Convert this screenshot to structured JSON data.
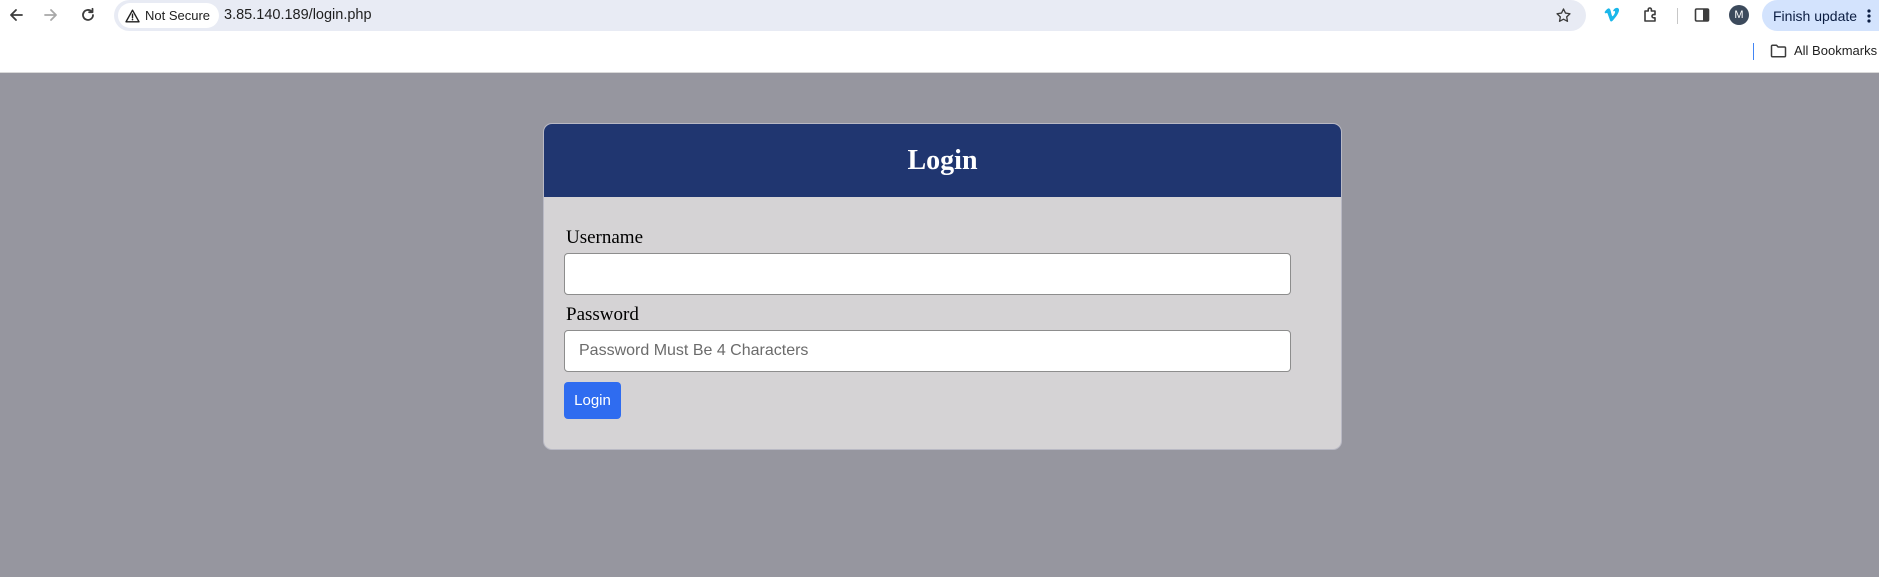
{
  "browser": {
    "security_label": "Not Secure",
    "url": "3.85.140.189/login.php",
    "profile_initial": "M",
    "update_label": "Finish update",
    "bookmarks_label": "All Bookmarks",
    "icons": [
      "back-icon",
      "forward-icon",
      "reload-icon",
      "warning-icon",
      "star-icon",
      "vimeo-icon",
      "extensions-icon",
      "side-panel-icon",
      "kebab-menu-icon",
      "folder-icon"
    ]
  },
  "login": {
    "title": "Login",
    "username_label": "Username",
    "username_value": "",
    "password_label": "Password",
    "password_placeholder": "Password Must Be 4 Characters",
    "submit_label": "Login"
  },
  "colors": {
    "page_background": "#96969f",
    "header": "#203670",
    "card": "#d5d3d5",
    "button": "#2f6cf0"
  }
}
